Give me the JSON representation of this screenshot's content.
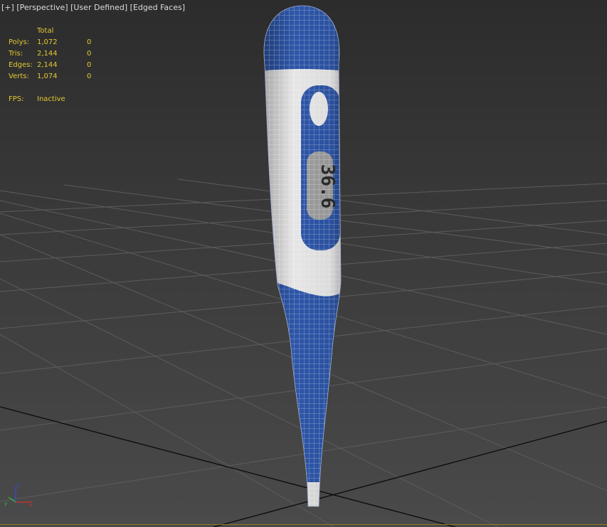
{
  "viewport": {
    "labels": [
      {
        "name": "viewport-menu-plus",
        "text": "[+]"
      },
      {
        "name": "viewport-menu-perspective",
        "text": "[Perspective]"
      },
      {
        "name": "viewport-menu-user-defined",
        "text": "[User Defined]"
      },
      {
        "name": "viewport-menu-edged-faces",
        "text": "[Edged Faces]"
      }
    ]
  },
  "stats": {
    "header": "Total",
    "rows": [
      {
        "label": "Polys:",
        "total": "1,072",
        "selected": "0"
      },
      {
        "label": "Tris:",
        "total": "2,144",
        "selected": "0"
      },
      {
        "label": "Edges:",
        "total": "2,144",
        "selected": "0"
      },
      {
        "label": "Verts:",
        "total": "1,074",
        "selected": "0"
      }
    ],
    "fps_label": "FPS:",
    "fps_value": "Inactive"
  },
  "model": {
    "display_reading": "36.6"
  },
  "axis": {
    "x": "x",
    "y": "y",
    "z": "z"
  },
  "colors": {
    "stats_text": "#e3c832",
    "mesh_blue": "#2e56a8",
    "mesh_white": "#e8e8e8",
    "wire": "#ffffff",
    "grid": "#5c5c5c",
    "grid_main": "#0a0a0a"
  }
}
